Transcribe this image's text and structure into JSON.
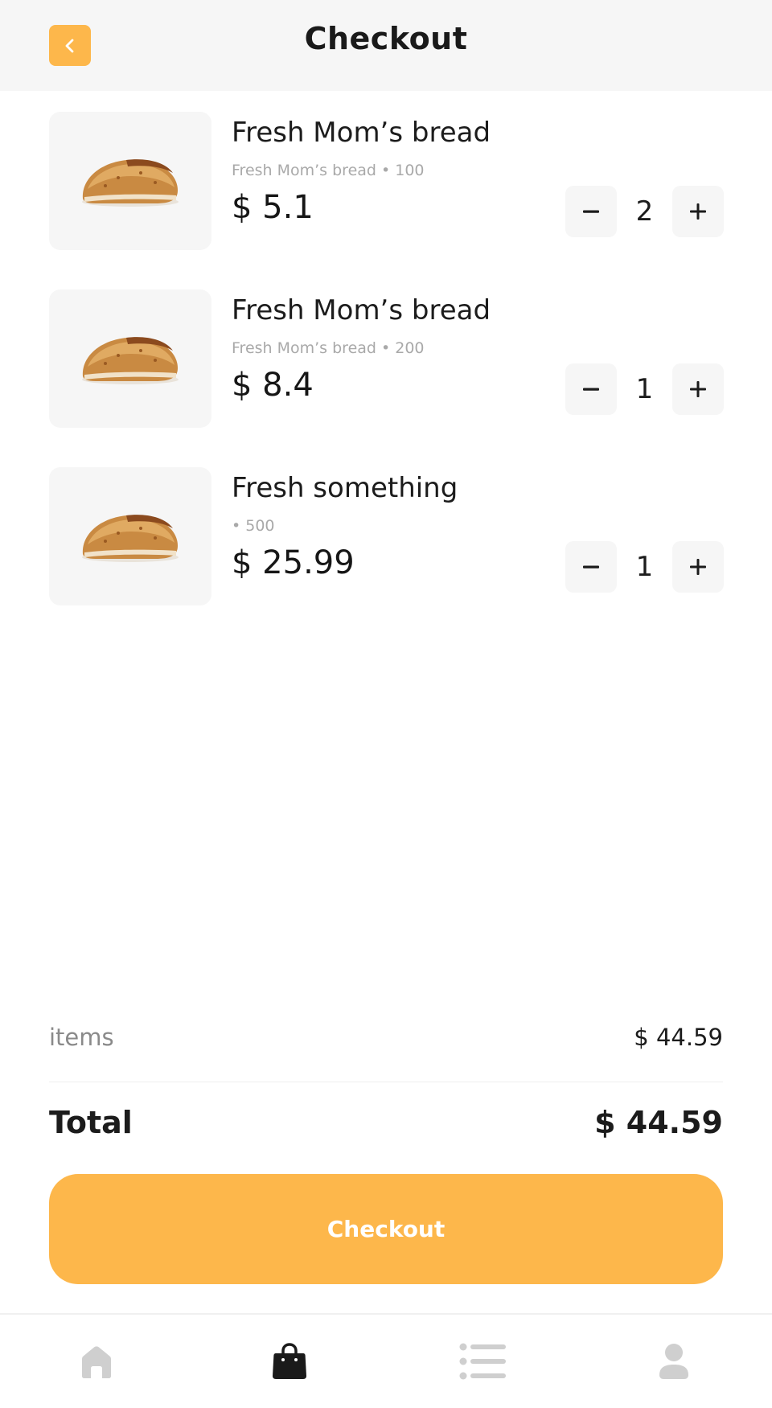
{
  "header": {
    "title": "Checkout",
    "back_icon": "chevron-left-icon",
    "accent_color": "#FDB74B"
  },
  "cart": {
    "items": [
      {
        "name": "Fresh Mom’s bread",
        "subtitle": "Fresh Mom’s bread • 100",
        "price": "$ 5.1",
        "quantity": "2",
        "minus_label": "−",
        "plus_label": "+",
        "image": "bread-image"
      },
      {
        "name": "Fresh Mom’s bread",
        "subtitle": "Fresh Mom’s bread • 200",
        "price": "$ 8.4",
        "quantity": "1",
        "minus_label": "−",
        "plus_label": "+",
        "image": "bread-image"
      },
      {
        "name": "Fresh something",
        "subtitle": " • 500",
        "price": "$ 25.99",
        "quantity": "1",
        "minus_label": "−",
        "plus_label": "+",
        "image": "bread-image"
      }
    ]
  },
  "summary": {
    "items_label": "items",
    "items_value": "$ 44.59",
    "total_label": "Total",
    "total_value": "$ 44.59"
  },
  "checkout_button": {
    "label": "Checkout"
  },
  "tabbar": {
    "tabs": [
      {
        "icon": "home-icon",
        "active": false
      },
      {
        "icon": "shopping-bag-icon",
        "active": true
      },
      {
        "icon": "list-icon",
        "active": false
      },
      {
        "icon": "profile-icon",
        "active": false
      }
    ],
    "active_color": "#1A1A1A",
    "inactive_color": "#CFCFCF"
  }
}
